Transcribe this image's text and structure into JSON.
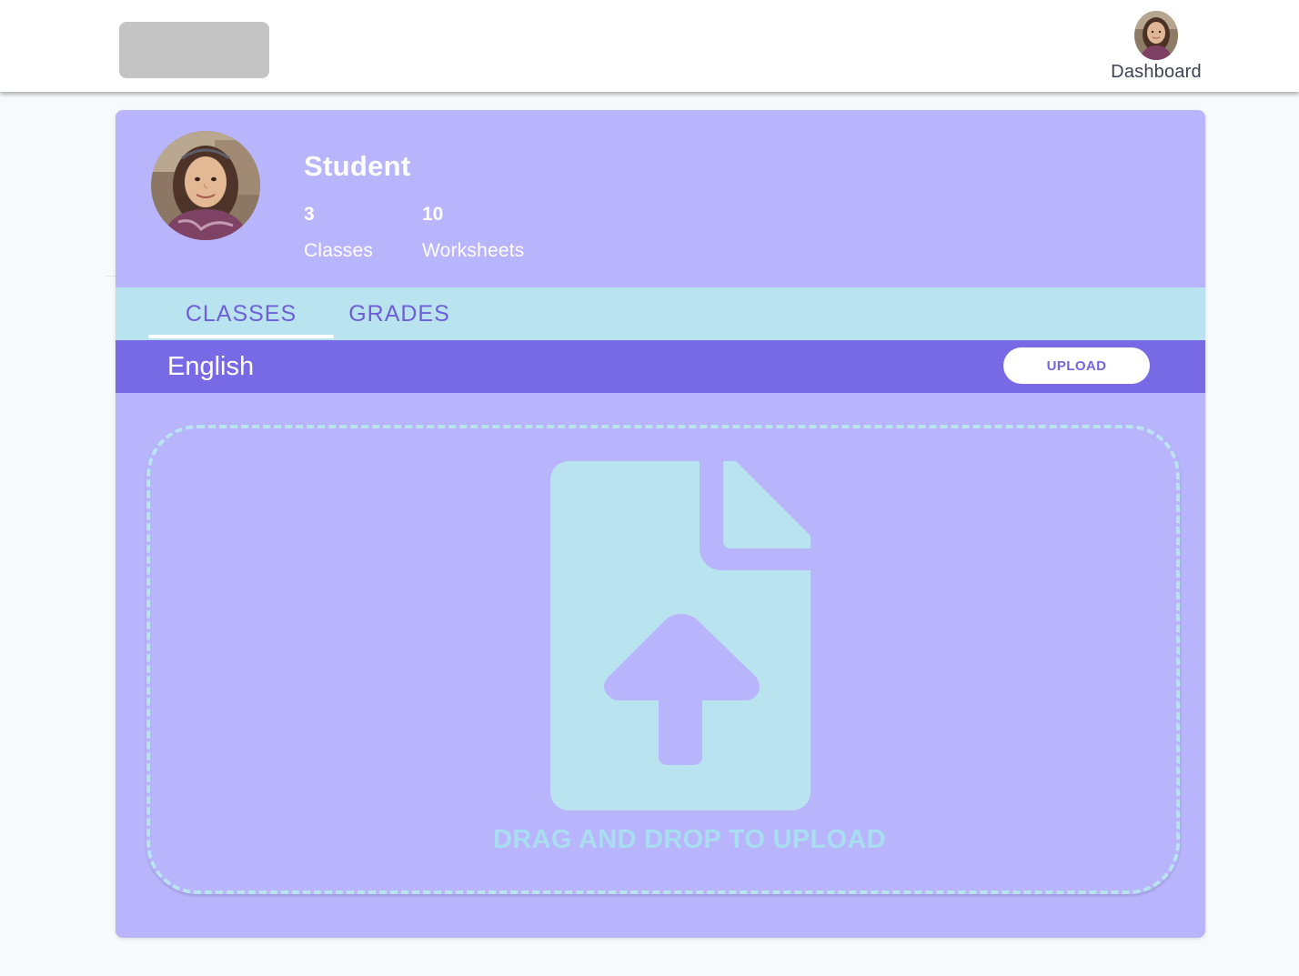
{
  "header": {
    "nav_user_label": "Dashboard"
  },
  "profile": {
    "name": "Student",
    "stats": [
      {
        "value": "3",
        "label": "Classes"
      },
      {
        "value": "10",
        "label": "Worksheets"
      }
    ]
  },
  "tabs": [
    {
      "label": "CLASSES",
      "active": true
    },
    {
      "label": "GRADES",
      "active": false
    }
  ],
  "class_bar": {
    "class_name": "English",
    "upload_label": "UPLOAD"
  },
  "dropzone": {
    "text": "DRAG AND DROP TO UPLOAD",
    "icon": "file-upload-icon"
  },
  "colors": {
    "card": "#b8b5fd",
    "tabs_bg": "#b9e3ef",
    "accent": "#7869e5",
    "tab_text": "#6e5fd9",
    "dropzone_border": "#b9e3ef"
  }
}
